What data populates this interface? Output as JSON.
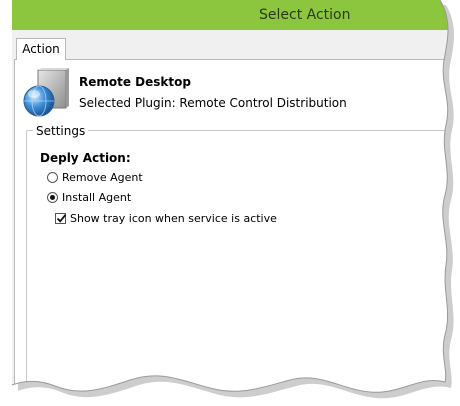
{
  "window": {
    "title": "Select Action",
    "titlebar_color": "#8cc63f"
  },
  "tabs": [
    {
      "label": "Action",
      "active": true
    }
  ],
  "plugin": {
    "icon": "remote-desktop-globe-icon",
    "name": "Remote Desktop",
    "selected_line": "Selected Plugin: Remote Control Distribution"
  },
  "settings": {
    "legend": "Settings",
    "deploy_label": "Deply Action:",
    "options": [
      {
        "label": "Remove Agent",
        "checked": false
      },
      {
        "label": "Install Agent",
        "checked": true
      }
    ],
    "show_tray_icon": {
      "label": "Show tray icon when service is active",
      "checked": true
    }
  }
}
